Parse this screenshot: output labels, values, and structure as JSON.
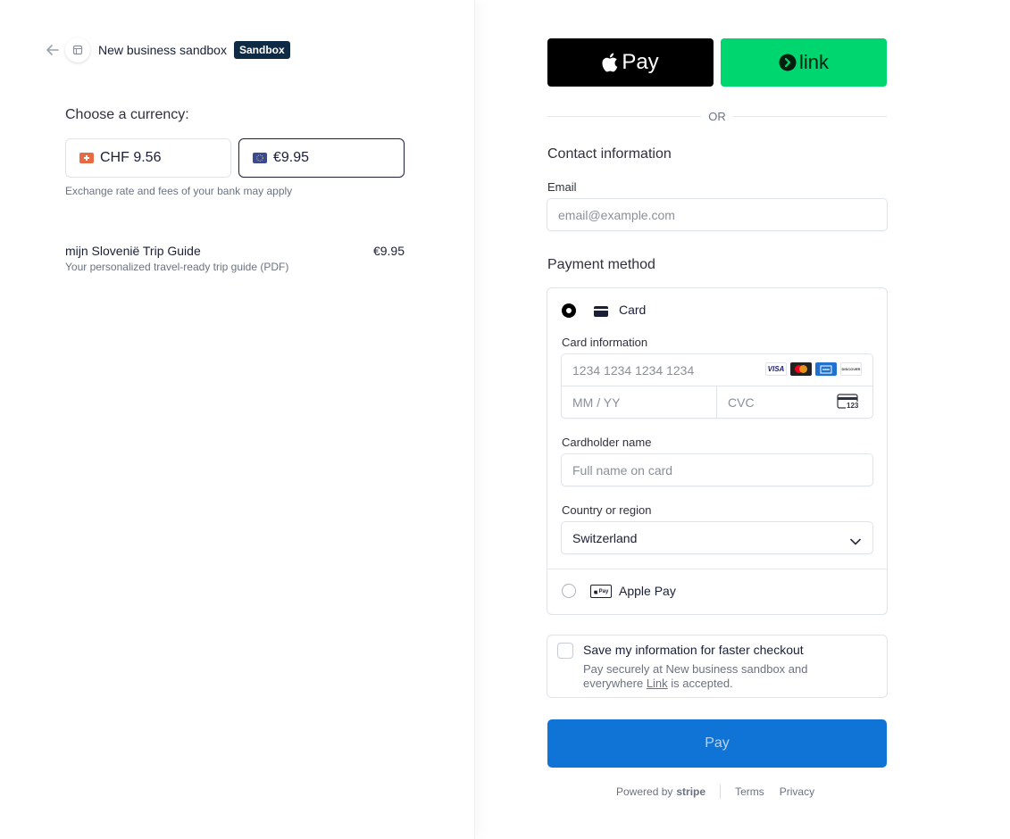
{
  "header": {
    "business_name": "New business sandbox",
    "badge": "Sandbox"
  },
  "currency": {
    "label": "Choose a currency:",
    "options": [
      {
        "amount": "CHF 9.56",
        "selected": false
      },
      {
        "amount": "€9.95",
        "selected": true
      }
    ],
    "note": "Exchange rate and fees of your bank may apply"
  },
  "item": {
    "name": "mijn Slovenië Trip Guide",
    "price": "€9.95",
    "description": "Your personalized travel-ready trip guide (PDF)"
  },
  "wallets": {
    "apple_pay": "Pay",
    "link": "link"
  },
  "or_label": "OR",
  "contact": {
    "title": "Contact information",
    "email_label": "Email",
    "email_placeholder": "email@example.com"
  },
  "payment": {
    "title": "Payment method",
    "card_label": "Card",
    "card_info_label": "Card information",
    "card_number_placeholder": "1234 1234 1234 1234",
    "expiry_placeholder": "MM / YY",
    "cvc_placeholder": "CVC",
    "cardholder_label": "Cardholder name",
    "cardholder_placeholder": "Full name on card",
    "country_label": "Country or region",
    "country_value": "Switzerland",
    "apple_pay_label": "Apple Pay",
    "brands": [
      "VISA",
      "DISCOVER"
    ],
    "cvc_icon_number": "123",
    "applepay_icon_text": "Pay"
  },
  "save": {
    "title": "Save my information for faster checkout",
    "desc_prefix": "Pay securely at New business sandbox and everywhere ",
    "desc_link": "Link",
    "desc_suffix": " is accepted."
  },
  "pay_button": "Pay",
  "footer": {
    "powered_by": "Powered by",
    "brand": "stripe",
    "terms": "Terms",
    "privacy": "Privacy"
  },
  "colors": {
    "pay_button": "#0f74d6",
    "link_green": "#00d66f",
    "badge": "#0f2a44"
  }
}
